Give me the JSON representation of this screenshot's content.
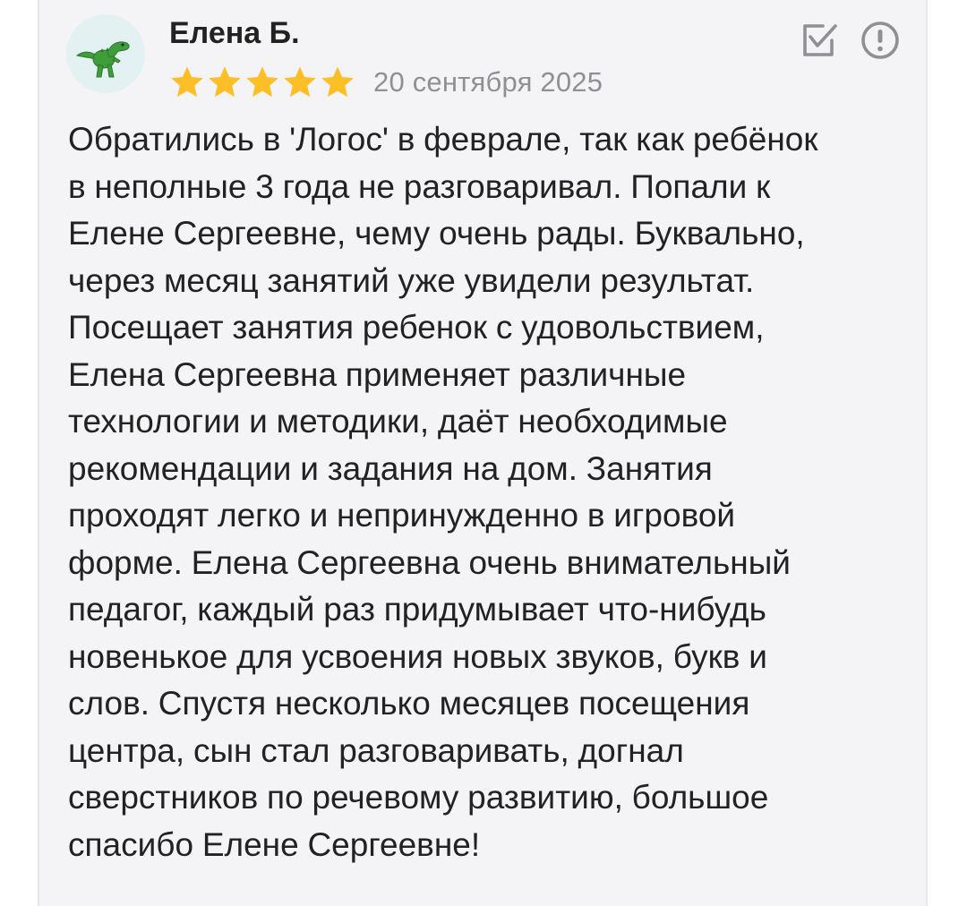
{
  "review": {
    "author_name": "Елена Б.",
    "avatar_icon": "dinosaur-icon",
    "rating": 5,
    "rating_max": 5,
    "star_color": "#fcbf28",
    "date": "20 сентября 2025",
    "actions": {
      "edit_icon": "check-square-icon",
      "report_icon": "exclamation-circle-icon"
    },
    "text_lines": [
      "Обратились в 'Логос' в феврале, так как ребёнок",
      "в неполные 3 года не разговаривал. Попали к",
      "Елене Сергеевне, чему очень рады. Буквально,",
      "через месяц занятий уже увидели результат.",
      "Посещает занятия ребенок с удовольствием,",
      "Елена Сергеевна применяет различные",
      "технологии и методики, даёт необходимые",
      "рекомендации и задания на дом. Занятия",
      "проходят легко и непринужденно в игровой",
      "форме. Елена Сергеевна очень внимательный",
      "педагог, каждый раз придумывает что-нибудь",
      "новенькое для усвоения новых звуков, букв и",
      "слов. Спустя несколько месяцев посещения",
      "центра, сын стал разговаривать, догнал",
      "сверстников по речевому развитию, большое",
      "спасибо Елене Сергеевне!"
    ]
  }
}
